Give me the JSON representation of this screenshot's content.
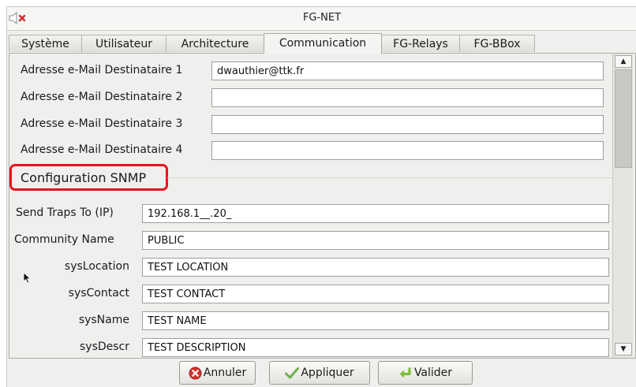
{
  "window": {
    "title": "FG-NET"
  },
  "tabs": [
    {
      "label": "Système"
    },
    {
      "label": "Utilisateur"
    },
    {
      "label": "Architecture"
    },
    {
      "label": "Communication",
      "active": true
    },
    {
      "label": "FG-Relays"
    },
    {
      "label": "FG-BBox"
    }
  ],
  "email": {
    "recipients": [
      {
        "label": "Adresse e-Mail Destinataire 1",
        "value": "dwauthier@ttk.fr"
      },
      {
        "label": "Adresse e-Mail Destinataire 2",
        "value": ""
      },
      {
        "label": "Adresse e-Mail Destinataire 3",
        "value": ""
      },
      {
        "label": "Adresse e-Mail Destinataire 4",
        "value": ""
      }
    ]
  },
  "snmp": {
    "section_title": "Configuration SNMP",
    "fields": [
      {
        "label": "Send Traps To (IP)",
        "value": "192.168.1__.20_"
      },
      {
        "label": "Community Name",
        "value": "PUBLIC"
      },
      {
        "label": "sysLocation",
        "value": "TEST LOCATION"
      },
      {
        "label": "sysContact",
        "value": "TEST CONTACT"
      },
      {
        "label": "sysName",
        "value": "TEST NAME"
      },
      {
        "label": "sysDescr",
        "value": "TEST DESCRIPTION"
      }
    ]
  },
  "buttons": {
    "cancel": {
      "label": "Annuler",
      "icon": "cancel-x-icon",
      "color": "#d9302b"
    },
    "apply": {
      "label": "Appliquer",
      "icon": "checkmark-icon",
      "color": "#6fb24a"
    },
    "validate": {
      "label": "Valider",
      "icon": "enter-arrow-icon",
      "color": "#7bbf3a"
    }
  },
  "colors": {
    "highlight": "#e8131b",
    "background": "#efefed"
  }
}
